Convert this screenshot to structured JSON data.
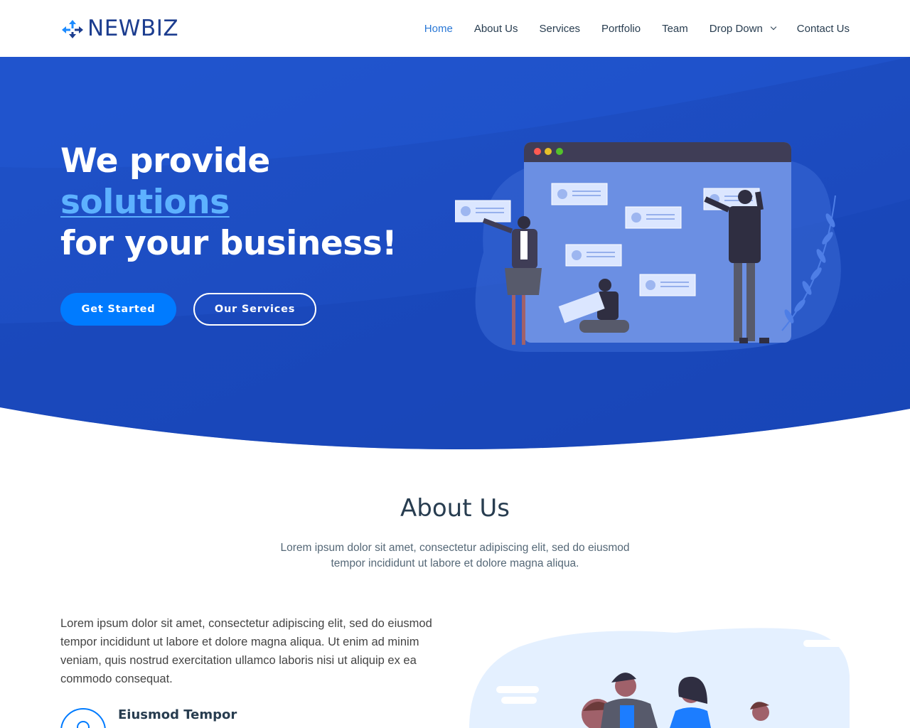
{
  "brand": {
    "name": "NEWBIZ",
    "logo_icon": "arrows-expand-icon"
  },
  "nav": {
    "items": [
      {
        "label": "Home",
        "active": true
      },
      {
        "label": "About Us"
      },
      {
        "label": "Services"
      },
      {
        "label": "Portfolio"
      },
      {
        "label": "Team"
      },
      {
        "label": "Drop Down",
        "icon": "chevron-down-icon"
      },
      {
        "label": "Contact Us"
      }
    ]
  },
  "hero": {
    "title_line1": "We provide",
    "title_highlight": "solutions",
    "title_line3": "for your business!",
    "primary_button": "Get Started",
    "secondary_button": "Our Services"
  },
  "about": {
    "title": "About Us",
    "subtitle": "Lorem ipsum dolor sit amet, consectetur adipiscing elit, sed do eiusmod tempor incididunt ut labore et dolore magna aliqua.",
    "body": "Lorem ipsum dolor sit amet, consectetur adipiscing elit, sed do eiusmod tempor incididunt ut labore et dolore magna aliqua. Ut enim ad minim veniam, quis nostrud exercitation ullamco laboris nisi ut aliquip ex ea commodo consequat.",
    "feature_title": "Eiusmod Tempor"
  },
  "colors": {
    "primary": "#007bff",
    "hero_bg": "#1c4fc6",
    "heading": "#283d50",
    "highlight": "#5db1ff"
  }
}
